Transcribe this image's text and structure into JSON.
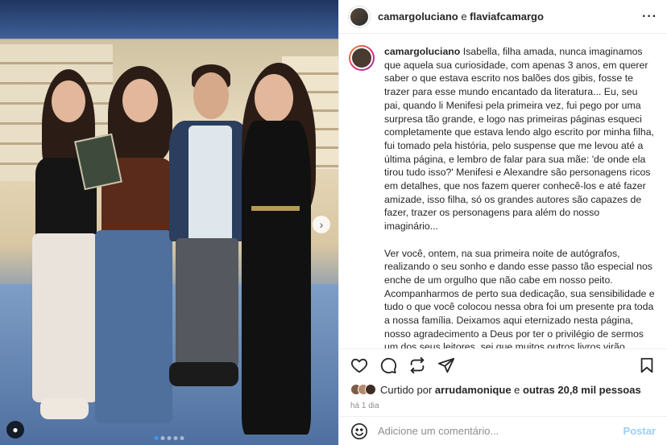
{
  "header": {
    "user1": "camargoluciano",
    "joiner": " e ",
    "user2": "flaviafcamargo",
    "more_icon": "more-horizontal-icon"
  },
  "caption": {
    "username": "camargoluciano",
    "text": "Isabella, filha amada, nunca imaginamos que aquela sua curiosidade, com apenas 3 anos, em querer saber o que estava escrito nos balões dos gibis, fosse te trazer para esse mundo encantado da literatura... Eu, seu pai, quando li Menifesi pela primeira vez, fui pego por uma surpresa tão grande, e logo nas primeiras páginas esqueci completamente que estava lendo algo escrito por minha filha, fui tomado pela história, pelo suspense que me levou até a última página, e lembro de falar para sua mãe: 'de onde ela tirou tudo isso?' Menifesi e Alexandre são personagens ricos em detalhes, que nos fazem querer conhecê-los e até fazer amizade, isso filha, só os grandes autores são capazes de fazer, trazer os personagens para além do nosso imaginário...\n\nVer você, ontem, na sua primeira noite de autógrafos, realizando o seu sonho e dando esse passo tão especial nos enche de um orgulho que não cabe em nosso peito. Acompanharmos de perto sua dedicação, sua sensibilidade e tudo o que você colocou nessa obra foi um presente pra toda a nossa família. Deixamos aqui eternizado nesta página, nosso agradecimento a Deus por ter o privilégio de sermos um dos seus leitores, sei que muitos outros livros virão, novos personagens... e nós com certeza viveremos com eles as histórias criadas por você.... Nós te amamos e estaremos sempre aqui, aplaudindo cada conquista sua! Hoje, seu livro deixa de ser só nosso, passa a ser do"
  },
  "actions": {
    "like_icon": "heart-icon",
    "comment_icon": "comment-icon",
    "share_icon": "repost-icon",
    "send_icon": "send-icon",
    "save_icon": "bookmark-icon"
  },
  "likes": {
    "prefix": "Curtido por ",
    "user": "arrudamonique",
    "middle": " e ",
    "others": "outras 20,8 mil pessoas"
  },
  "time": "há 1 dia",
  "comment": {
    "placeholder": "Adicione um comentário...",
    "post_label": "Postar"
  },
  "photo": {
    "carousel_index": 1,
    "carousel_count": 5
  },
  "colors": {
    "accent": "#3897f0",
    "post_disabled": "#9ccef8"
  }
}
